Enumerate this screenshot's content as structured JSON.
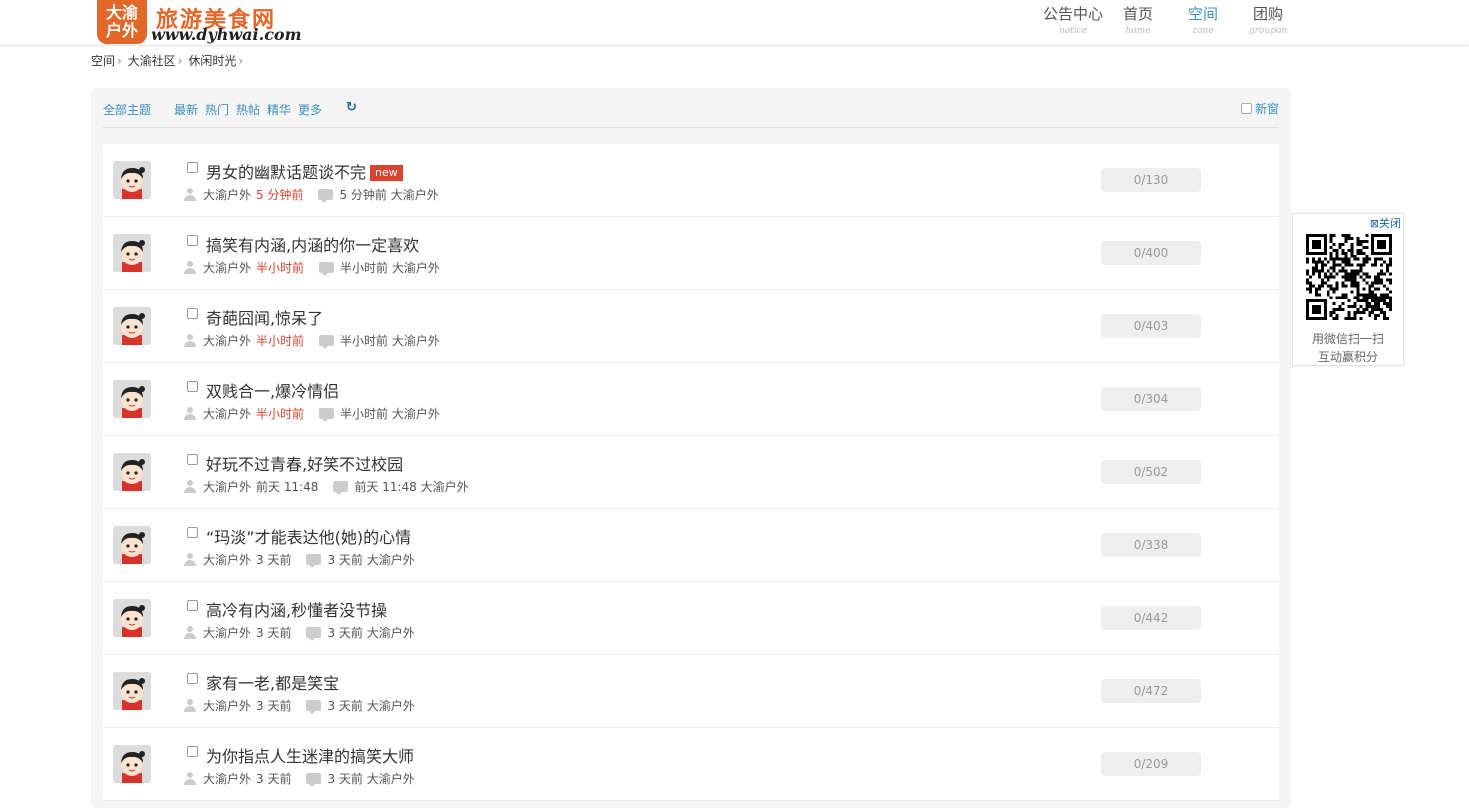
{
  "header": {
    "logo_badge_top": "大渝",
    "logo_badge_bottom": "户外",
    "logo_title": "旅游美食网",
    "logo_url": "www.dyhwai.com",
    "nav": [
      {
        "label": "公告中心",
        "sub": "notice"
      },
      {
        "label": "首页",
        "sub": "home"
      },
      {
        "label": "空间",
        "sub": "zone"
      },
      {
        "label": "团购",
        "sub": "groupon"
      }
    ]
  },
  "breadcrumb": [
    "空间",
    "大渝社区",
    "休闲时光"
  ],
  "toolbar": {
    "all_topics": "全部主题",
    "filters": [
      "最新",
      "热门",
      "热帖",
      "精华",
      "更多"
    ],
    "refresh_icon": "refresh-icon",
    "new_window": "新窗"
  },
  "threads": [
    {
      "title": "男女的幽默话题谈不完",
      "is_new": true,
      "new_label": "new",
      "author": "大渝户外",
      "time": "5 分钟前",
      "hot": true,
      "last_reply": "5 分钟前 大渝户外",
      "stat": "0/130"
    },
    {
      "title": "搞笑有内涵,内涵的你一定喜欢",
      "is_new": false,
      "author": "大渝户外",
      "time": "半小时前",
      "hot": true,
      "last_reply": "半小时前 大渝户外",
      "stat": "0/400"
    },
    {
      "title": "奇葩囧闻,惊呆了",
      "is_new": false,
      "author": "大渝户外",
      "time": "半小时前",
      "hot": true,
      "last_reply": "半小时前 大渝户外",
      "stat": "0/403"
    },
    {
      "title": "双贱合一,爆冷情侣",
      "is_new": false,
      "author": "大渝户外",
      "time": "半小时前",
      "hot": true,
      "last_reply": "半小时前 大渝户外",
      "stat": "0/304"
    },
    {
      "title": "好玩不过青春,好笑不过校园",
      "is_new": false,
      "author": "大渝户外",
      "time": "前天 11:48",
      "hot": false,
      "last_reply": "前天 11:48 大渝户外",
      "stat": "0/502"
    },
    {
      "title": "“玛淡”才能表达他(她)的心情",
      "is_new": false,
      "author": "大渝户外",
      "time": "3 天前",
      "hot": false,
      "last_reply": "3 天前 大渝户外",
      "stat": "0/338"
    },
    {
      "title": "高冷有内涵,秒懂者没节操",
      "is_new": false,
      "author": "大渝户外",
      "time": "3 天前",
      "hot": false,
      "last_reply": "3 天前 大渝户外",
      "stat": "0/442"
    },
    {
      "title": "家有一老,都是笑宝",
      "is_new": false,
      "author": "大渝户外",
      "time": "3 天前",
      "hot": false,
      "last_reply": "3 天前 大渝户外",
      "stat": "0/472"
    },
    {
      "title": "为你指点人生迷津的搞笑大师",
      "is_new": false,
      "author": "大渝户外",
      "time": "3 天前",
      "hot": false,
      "last_reply": "3 天前 大渝户外",
      "stat": "0/209"
    }
  ],
  "qr_panel": {
    "close_label": "关闭",
    "caption_line1": "用微信扫一扫",
    "caption_line2": "互动赢积分"
  },
  "colors": {
    "brand": "#e4672a",
    "link": "#3b8fc8",
    "hot": "#d9432f"
  }
}
